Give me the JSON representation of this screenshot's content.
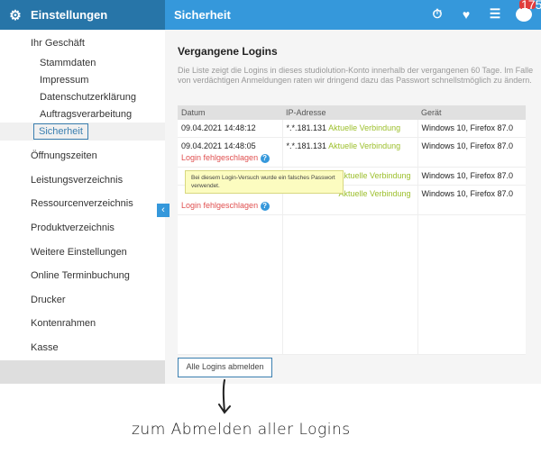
{
  "header": {
    "section": "Einstellungen",
    "page": "Sicherheit",
    "badge_count": "175",
    "coin_label": "S",
    "icons": [
      "gear-icon",
      "stopwatch-icon",
      "heartbeat-icon",
      "list-icon",
      "coin-icon"
    ]
  },
  "sidebar": {
    "group": "Ihr Geschäft",
    "sub_items": [
      "Stammdaten",
      "Impressum",
      "Datenschutzerklärung",
      "Auftragsverarbeitung",
      "Sicherheit"
    ],
    "items": [
      "Öffnungszeiten",
      "Leistungsverzeichnis",
      "Ressourcenverzeichnis",
      "Produktverzeichnis",
      "Weitere Einstellungen",
      "Online Terminbuchung",
      "Drucker",
      "Kontenrahmen",
      "Kasse"
    ]
  },
  "main": {
    "title": "Vergangene Logins",
    "description": "Die Liste zeigt die Logins in dieses studiolution-Konto innerhalb der vergangenen 60 Tage. Im Falle von verdächtigen Anmeldungen raten wir dringend dazu das Passwort schnellstmöglich zu ändern.",
    "columns": [
      "Datum",
      "IP-Adresse",
      "Gerät"
    ],
    "rows": [
      {
        "date": "09.04.2021 14:48:12",
        "status": "",
        "ip": "*.*.181.131",
        "ip_note": "Aktuelle Verbindung",
        "device": "Windows 10, Firefox 87.0"
      },
      {
        "date": "09.04.2021 14:48:05",
        "status": "Login fehlgeschlagen",
        "ip": "*.*.181.131",
        "ip_note": "Aktuelle Verbindung",
        "device": "Windows 10, Firefox 87.0"
      },
      {
        "date": "",
        "status": "",
        "ip": "",
        "ip_note": "Aktuelle Verbindung",
        "device": "Windows 10, Firefox 87.0"
      },
      {
        "date": "",
        "status": "Login fehlgeschlagen",
        "ip": "",
        "ip_note": "Aktuelle Verbindung",
        "device": "Windows 10, Firefox 87.0"
      }
    ],
    "tooltip": "Bei diesem Login-Versuch wurde ein falsches Passwort verwendet.",
    "logout_all": "Alle Logins abmelden"
  },
  "annotation": "zum Abmelden aller Logins",
  "colors": {
    "header_dark": "#2775a8",
    "header": "#3598db",
    "success": "#9cbf2b",
    "error": "#e05050"
  }
}
